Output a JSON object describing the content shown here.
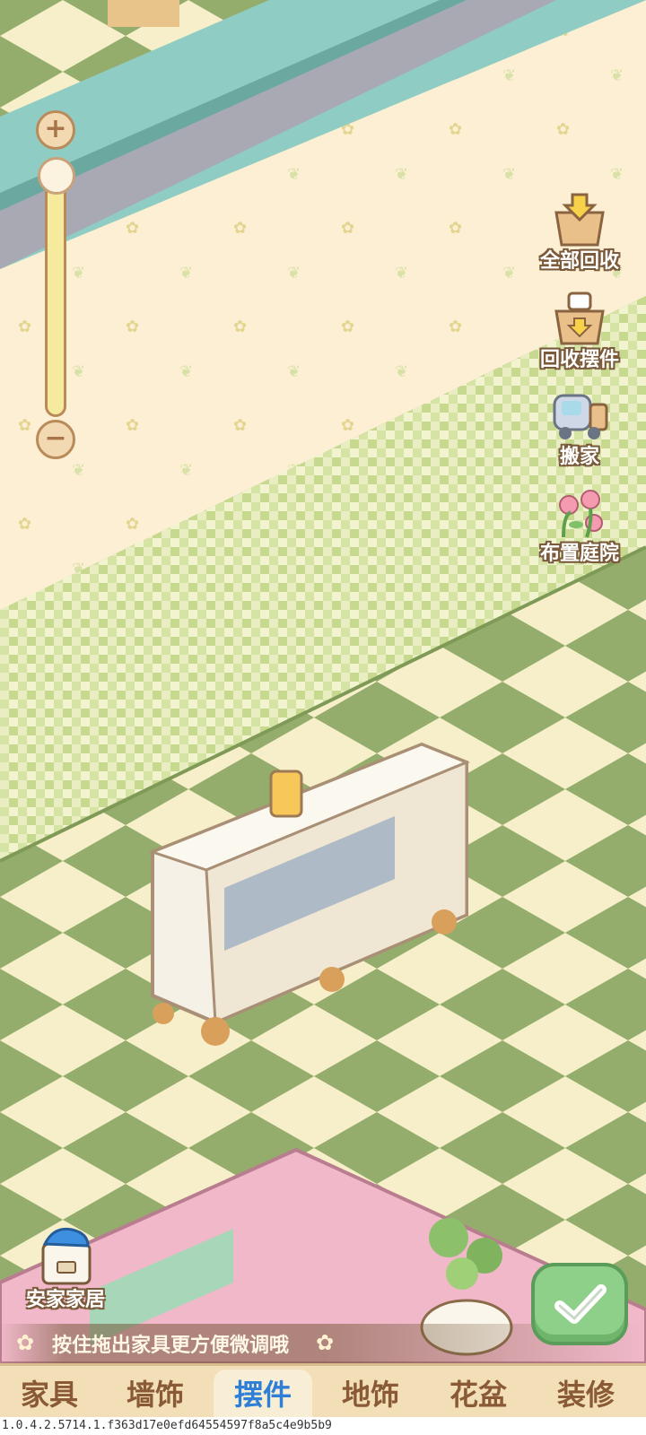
{
  "zoom": {
    "in_icon": "plus-icon",
    "out_icon": "minus-icon",
    "level": 0.0
  },
  "actions": [
    {
      "label": "全部回收",
      "icon": "recycle-all-icon"
    },
    {
      "label": "回收摆件",
      "icon": "recycle-ornament-icon"
    },
    {
      "label": "搬家",
      "icon": "moving-truck-icon"
    },
    {
      "label": "布置庭院",
      "icon": "garden-flower-icon"
    }
  ],
  "shop": {
    "label": "安家家居",
    "icon": "shop-bag-icon"
  },
  "hint": {
    "text": "按住拖出家具更方便微调哦"
  },
  "confirm": {
    "icon": "check-icon"
  },
  "tabs": [
    {
      "label": "家具",
      "active": false
    },
    {
      "label": "墙饰",
      "active": false
    },
    {
      "label": "摆件",
      "active": true
    },
    {
      "label": "地饰",
      "active": false
    },
    {
      "label": "花盆",
      "active": false
    },
    {
      "label": "装修",
      "active": false
    }
  ],
  "version": "1.0.4.2.5714.1.f363d17e0efd64554597f8a5c4e9b5b9",
  "colors": {
    "floor_green": "#94ad6c",
    "floor_cream": "#f7efc9",
    "wall": "#fbefd6",
    "accent_blue": "#2f7fd6"
  }
}
